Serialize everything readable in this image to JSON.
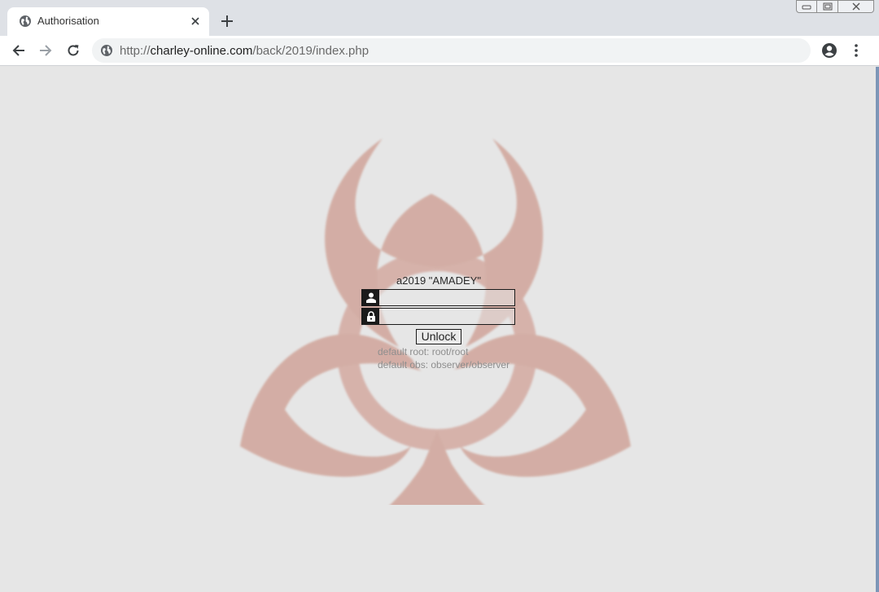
{
  "tab": {
    "title": "Authorisation",
    "icon": "globe-icon"
  },
  "address_bar": {
    "scheme": "http://",
    "host": "charley-online.com",
    "path": "/back/2019/index.php"
  },
  "login": {
    "title": "a2019 \"AMADEY\"",
    "username_icon": "user-icon",
    "password_icon": "lock-icon",
    "username_value": "",
    "password_value": "",
    "unlock_label": "Unlock",
    "hint_root": "default root: root/root",
    "hint_obs": "default obs: observer/observer"
  },
  "colors": {
    "page_bg": "#e6e6e6",
    "hazard_symbol": "#c98a7a",
    "field_icon_bg": "#1b1b1b"
  }
}
